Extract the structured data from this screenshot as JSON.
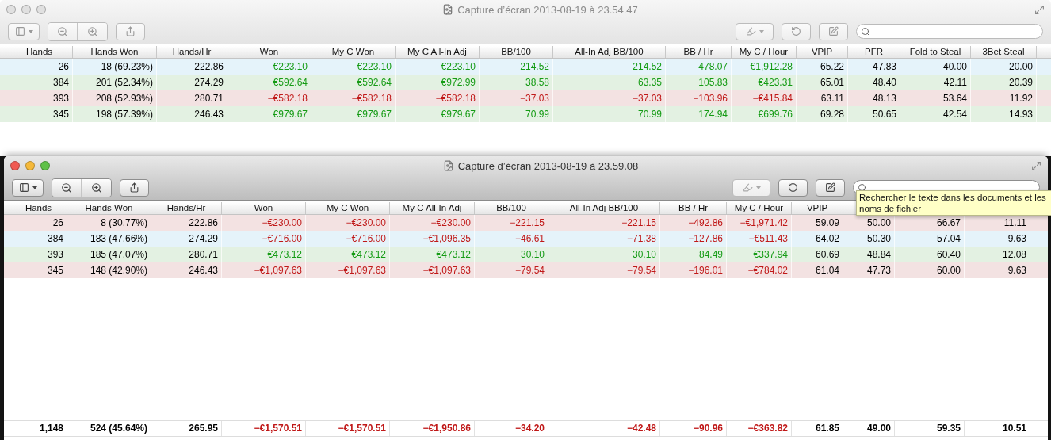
{
  "windows": [
    {
      "title": "Capture d’écran 2013-08-19 à 23.54.47",
      "active": false,
      "columns": [
        {
          "label": "Hands",
          "kind": "plain"
        },
        {
          "label": "Hands Won",
          "kind": "plain"
        },
        {
          "label": "Hands/Hr",
          "kind": "plain"
        },
        {
          "label": "Won",
          "kind": "money"
        },
        {
          "label": "My C Won",
          "kind": "money"
        },
        {
          "label": "My C All-In Adj",
          "kind": "money"
        },
        {
          "label": "BB/100",
          "kind": "money"
        },
        {
          "label": "All-In Adj BB/100",
          "kind": "money"
        },
        {
          "label": "BB / Hr",
          "kind": "money"
        },
        {
          "label": "My C / Hour",
          "kind": "money"
        },
        {
          "label": "VPIP",
          "kind": "plain"
        },
        {
          "label": "PFR",
          "kind": "plain"
        },
        {
          "label": "Fold to Steal",
          "kind": "plain"
        },
        {
          "label": "3Bet Steal",
          "kind": "plain"
        }
      ],
      "rows": [
        {
          "color": "#e5f3fa",
          "loss": false,
          "cells": [
            "26",
            "18 (69.23%)",
            "222.86",
            "€223.10",
            "€223.10",
            "€223.10",
            "214.52",
            "214.52",
            "478.07",
            "€1,912.28",
            "65.22",
            "47.83",
            "40.00",
            "20.00"
          ]
        },
        {
          "color": "#e3f1e2",
          "loss": false,
          "cells": [
            "384",
            "201 (52.34%)",
            "274.29",
            "€592.64",
            "€592.64",
            "€972.99",
            "38.58",
            "63.35",
            "105.83",
            "€423.31",
            "65.01",
            "48.40",
            "42.11",
            "20.39"
          ]
        },
        {
          "color": "#f3e2e2",
          "loss": true,
          "cells": [
            "393",
            "208 (52.93%)",
            "280.71",
            "−€582.18",
            "−€582.18",
            "−€582.18",
            "−37.03",
            "−37.03",
            "−103.96",
            "−€415.84",
            "63.11",
            "48.13",
            "53.64",
            "11.92"
          ]
        },
        {
          "color": "#e3f1e2",
          "loss": false,
          "cells": [
            "345",
            "198 (57.39%)",
            "246.43",
            "€979.67",
            "€979.67",
            "€979.67",
            "70.99",
            "70.99",
            "174.94",
            "€699.76",
            "69.28",
            "50.65",
            "42.54",
            "14.93"
          ]
        }
      ]
    },
    {
      "title": "Capture d’écran 2013-08-19 à 23.59.08",
      "active": true,
      "columns": [
        {
          "label": "Hands",
          "kind": "plain"
        },
        {
          "label": "Hands Won",
          "kind": "plain"
        },
        {
          "label": "Hands/Hr",
          "kind": "plain"
        },
        {
          "label": "Won",
          "kind": "money"
        },
        {
          "label": "My C Won",
          "kind": "money"
        },
        {
          "label": "My C All-In Adj",
          "kind": "money"
        },
        {
          "label": "BB/100",
          "kind": "money"
        },
        {
          "label": "All-In Adj BB/100",
          "kind": "money"
        },
        {
          "label": "BB / Hr",
          "kind": "money"
        },
        {
          "label": "My C / Hour",
          "kind": "money"
        },
        {
          "label": "VPIP",
          "kind": "plain"
        }
      ],
      "rows": [
        {
          "color": "#f3e2e2",
          "loss": true,
          "cells": [
            "26",
            "8 (30.77%)",
            "222.86",
            "−€230.00",
            "−€230.00",
            "−€230.00",
            "−221.15",
            "−221.15",
            "−492.86",
            "−€1,971.42",
            "59.09",
            "50.00",
            "66.67",
            "11.11"
          ]
        },
        {
          "color": "#e5f3fa",
          "loss": true,
          "cells": [
            "384",
            "183 (47.66%)",
            "274.29",
            "−€716.00",
            "−€716.00",
            "−€1,096.35",
            "−46.61",
            "−71.38",
            "−127.86",
            "−€511.43",
            "64.02",
            "50.30",
            "57.04",
            "9.63"
          ]
        },
        {
          "color": "#e3f1e2",
          "loss": false,
          "cells": [
            "393",
            "185 (47.07%)",
            "280.71",
            "€473.12",
            "€473.12",
            "€473.12",
            "30.10",
            "30.10",
            "84.49",
            "€337.94",
            "60.69",
            "48.84",
            "60.40",
            "12.08"
          ]
        },
        {
          "color": "#f3e2e2",
          "loss": true,
          "cells": [
            "345",
            "148 (42.90%)",
            "246.43",
            "−€1,097.63",
            "−€1,097.63",
            "−€1,097.63",
            "−79.54",
            "−79.54",
            "−196.01",
            "−€784.02",
            "61.04",
            "47.73",
            "60.00",
            "9.63"
          ]
        }
      ],
      "total": {
        "loss": true,
        "cells": [
          "1,148",
          "524 (45.64%)",
          "265.95",
          "−€1,570.51",
          "−€1,570.51",
          "−€1,950.86",
          "−34.20",
          "−42.48",
          "−90.96",
          "−€363.82",
          "61.85",
          "49.00",
          "59.35",
          "10.51"
        ]
      },
      "tooltip": "Rechercher le texte dans les documents et les noms de fichier"
    }
  ]
}
